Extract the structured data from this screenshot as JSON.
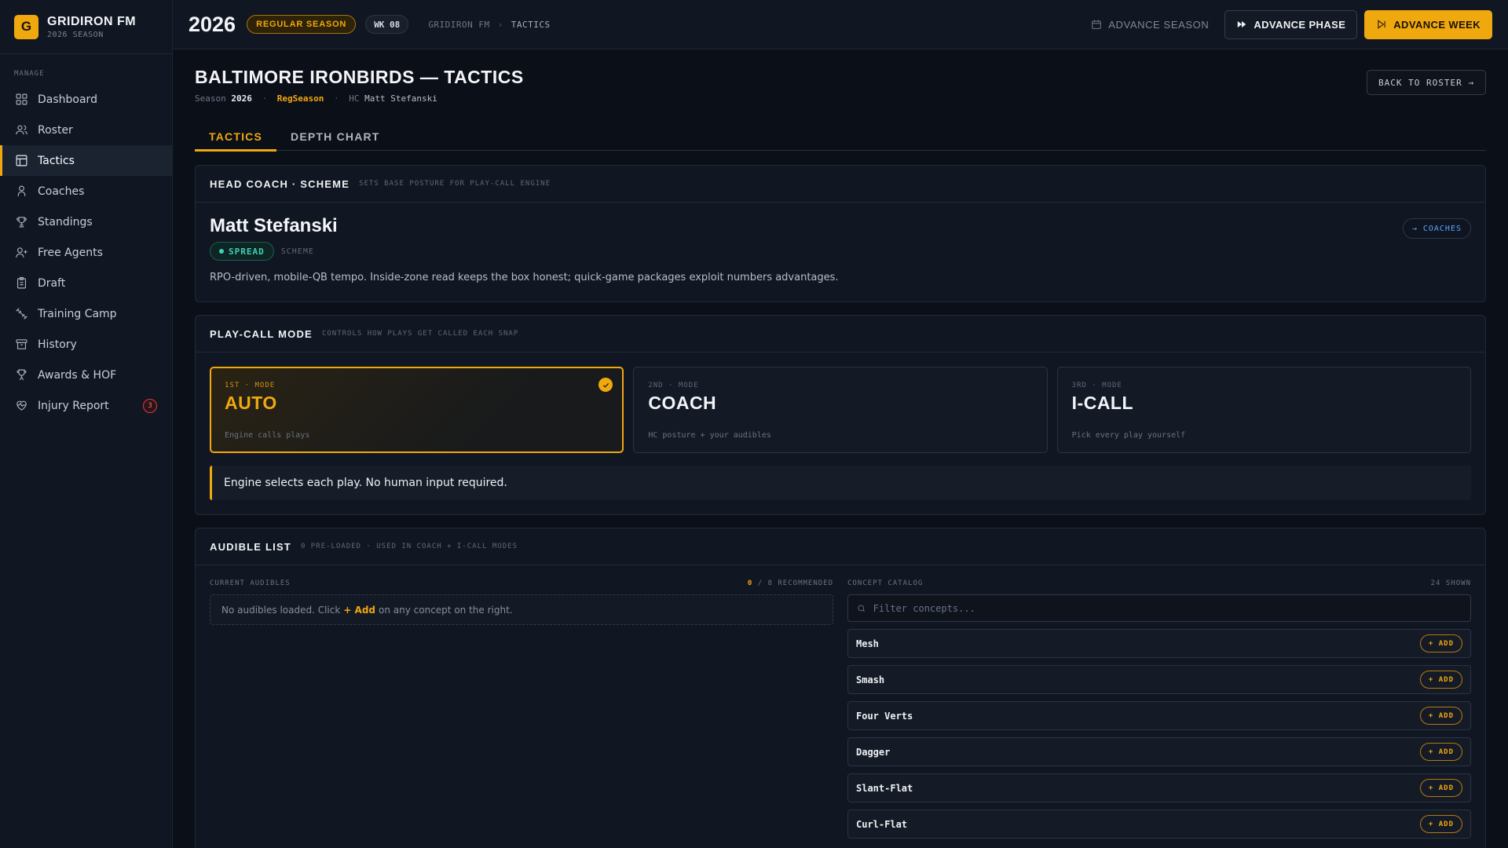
{
  "brand": {
    "logo": "G",
    "title": "GRIDIRON FM",
    "subtitle": "2026 SEASON"
  },
  "sidebar": {
    "section": "MANAGE",
    "items": [
      {
        "label": "Dashboard",
        "icon": "grid-icon"
      },
      {
        "label": "Roster",
        "icon": "users-icon"
      },
      {
        "label": "Tactics",
        "icon": "clipboard-layout-icon",
        "active": true
      },
      {
        "label": "Coaches",
        "icon": "person-icon"
      },
      {
        "label": "Standings",
        "icon": "trophy-icon"
      },
      {
        "label": "Free Agents",
        "icon": "user-plus-icon"
      },
      {
        "label": "Draft",
        "icon": "clipboard-icon"
      },
      {
        "label": "Training Camp",
        "icon": "dumbbell-icon"
      },
      {
        "label": "History",
        "icon": "archive-icon"
      },
      {
        "label": "Awards & HOF",
        "icon": "award-icon"
      },
      {
        "label": "Injury Report",
        "icon": "heart-pulse-icon",
        "badge": "3"
      }
    ]
  },
  "topbar": {
    "year": "2026",
    "phase": "REGULAR SEASON",
    "week": "WK 08",
    "breadcrumb": [
      "GRIDIRON FM",
      "TACTICS"
    ],
    "separator": "›",
    "advance_season": "ADVANCE SEASON",
    "advance_phase": "ADVANCE PHASE",
    "advance_week": "ADVANCE WEEK"
  },
  "page": {
    "title": "BALTIMORE IRONBIRDS — TACTICS",
    "meta": {
      "season_label": "Season",
      "season": "2026",
      "phase": "RegSeason",
      "dot": "·",
      "hc_label": "HC",
      "hc": "Matt Stefanski"
    },
    "back": "BACK TO ROSTER →",
    "tabs": [
      {
        "label": "TACTICS",
        "active": true
      },
      {
        "label": "DEPTH CHART"
      }
    ]
  },
  "head_coach": {
    "title": "HEAD COACH · SCHEME",
    "subtitle": "SETS BASE POSTURE FOR PLAY-CALL ENGINE",
    "name": "Matt Stefanski",
    "scheme": "SPREAD",
    "scheme_label": "SCHEME",
    "description": "RPO-driven, mobile-QB tempo. Inside-zone read keeps the box honest; quick-game packages exploit numbers advantages.",
    "coaches_link": "→ COACHES"
  },
  "play_call": {
    "title": "PLAY-CALL MODE",
    "subtitle": "CONTROLS HOW PLAYS GET CALLED EACH SNAP",
    "modes": [
      {
        "index": "1ST · MODE",
        "name": "AUTO",
        "desc": "Engine calls plays",
        "selected": true
      },
      {
        "index": "2ND · MODE",
        "name": "COACH",
        "desc": "HC posture + your audibles"
      },
      {
        "index": "3RD · MODE",
        "name": "I-CALL",
        "desc": "Pick every play yourself"
      }
    ],
    "note": "Engine selects each play. No human input required."
  },
  "audibles": {
    "title": "AUDIBLE LIST",
    "subtitle": "0 PRE-LOADED · USED IN COACH + I-CALL MODES",
    "current_label": "CURRENT AUDIBLES",
    "count": "0",
    "count_rest": " / 8 RECOMMENDED",
    "empty_pre": "No audibles loaded. Click",
    "empty_add": "+ Add",
    "empty_post": "on any concept on the right.",
    "catalog_label": "CONCEPT CATALOG",
    "catalog_count": "24 SHOWN",
    "filter_placeholder": "Filter concepts...",
    "add_label": "+ ADD",
    "concepts": [
      "Mesh",
      "Smash",
      "Four Verts",
      "Dagger",
      "Slant-Flat",
      "Curl-Flat"
    ]
  },
  "colors": {
    "accent": "#f0a80f",
    "scheme": "#3fd0b6",
    "link": "#5aa6ff",
    "danger": "#e03b3b"
  }
}
